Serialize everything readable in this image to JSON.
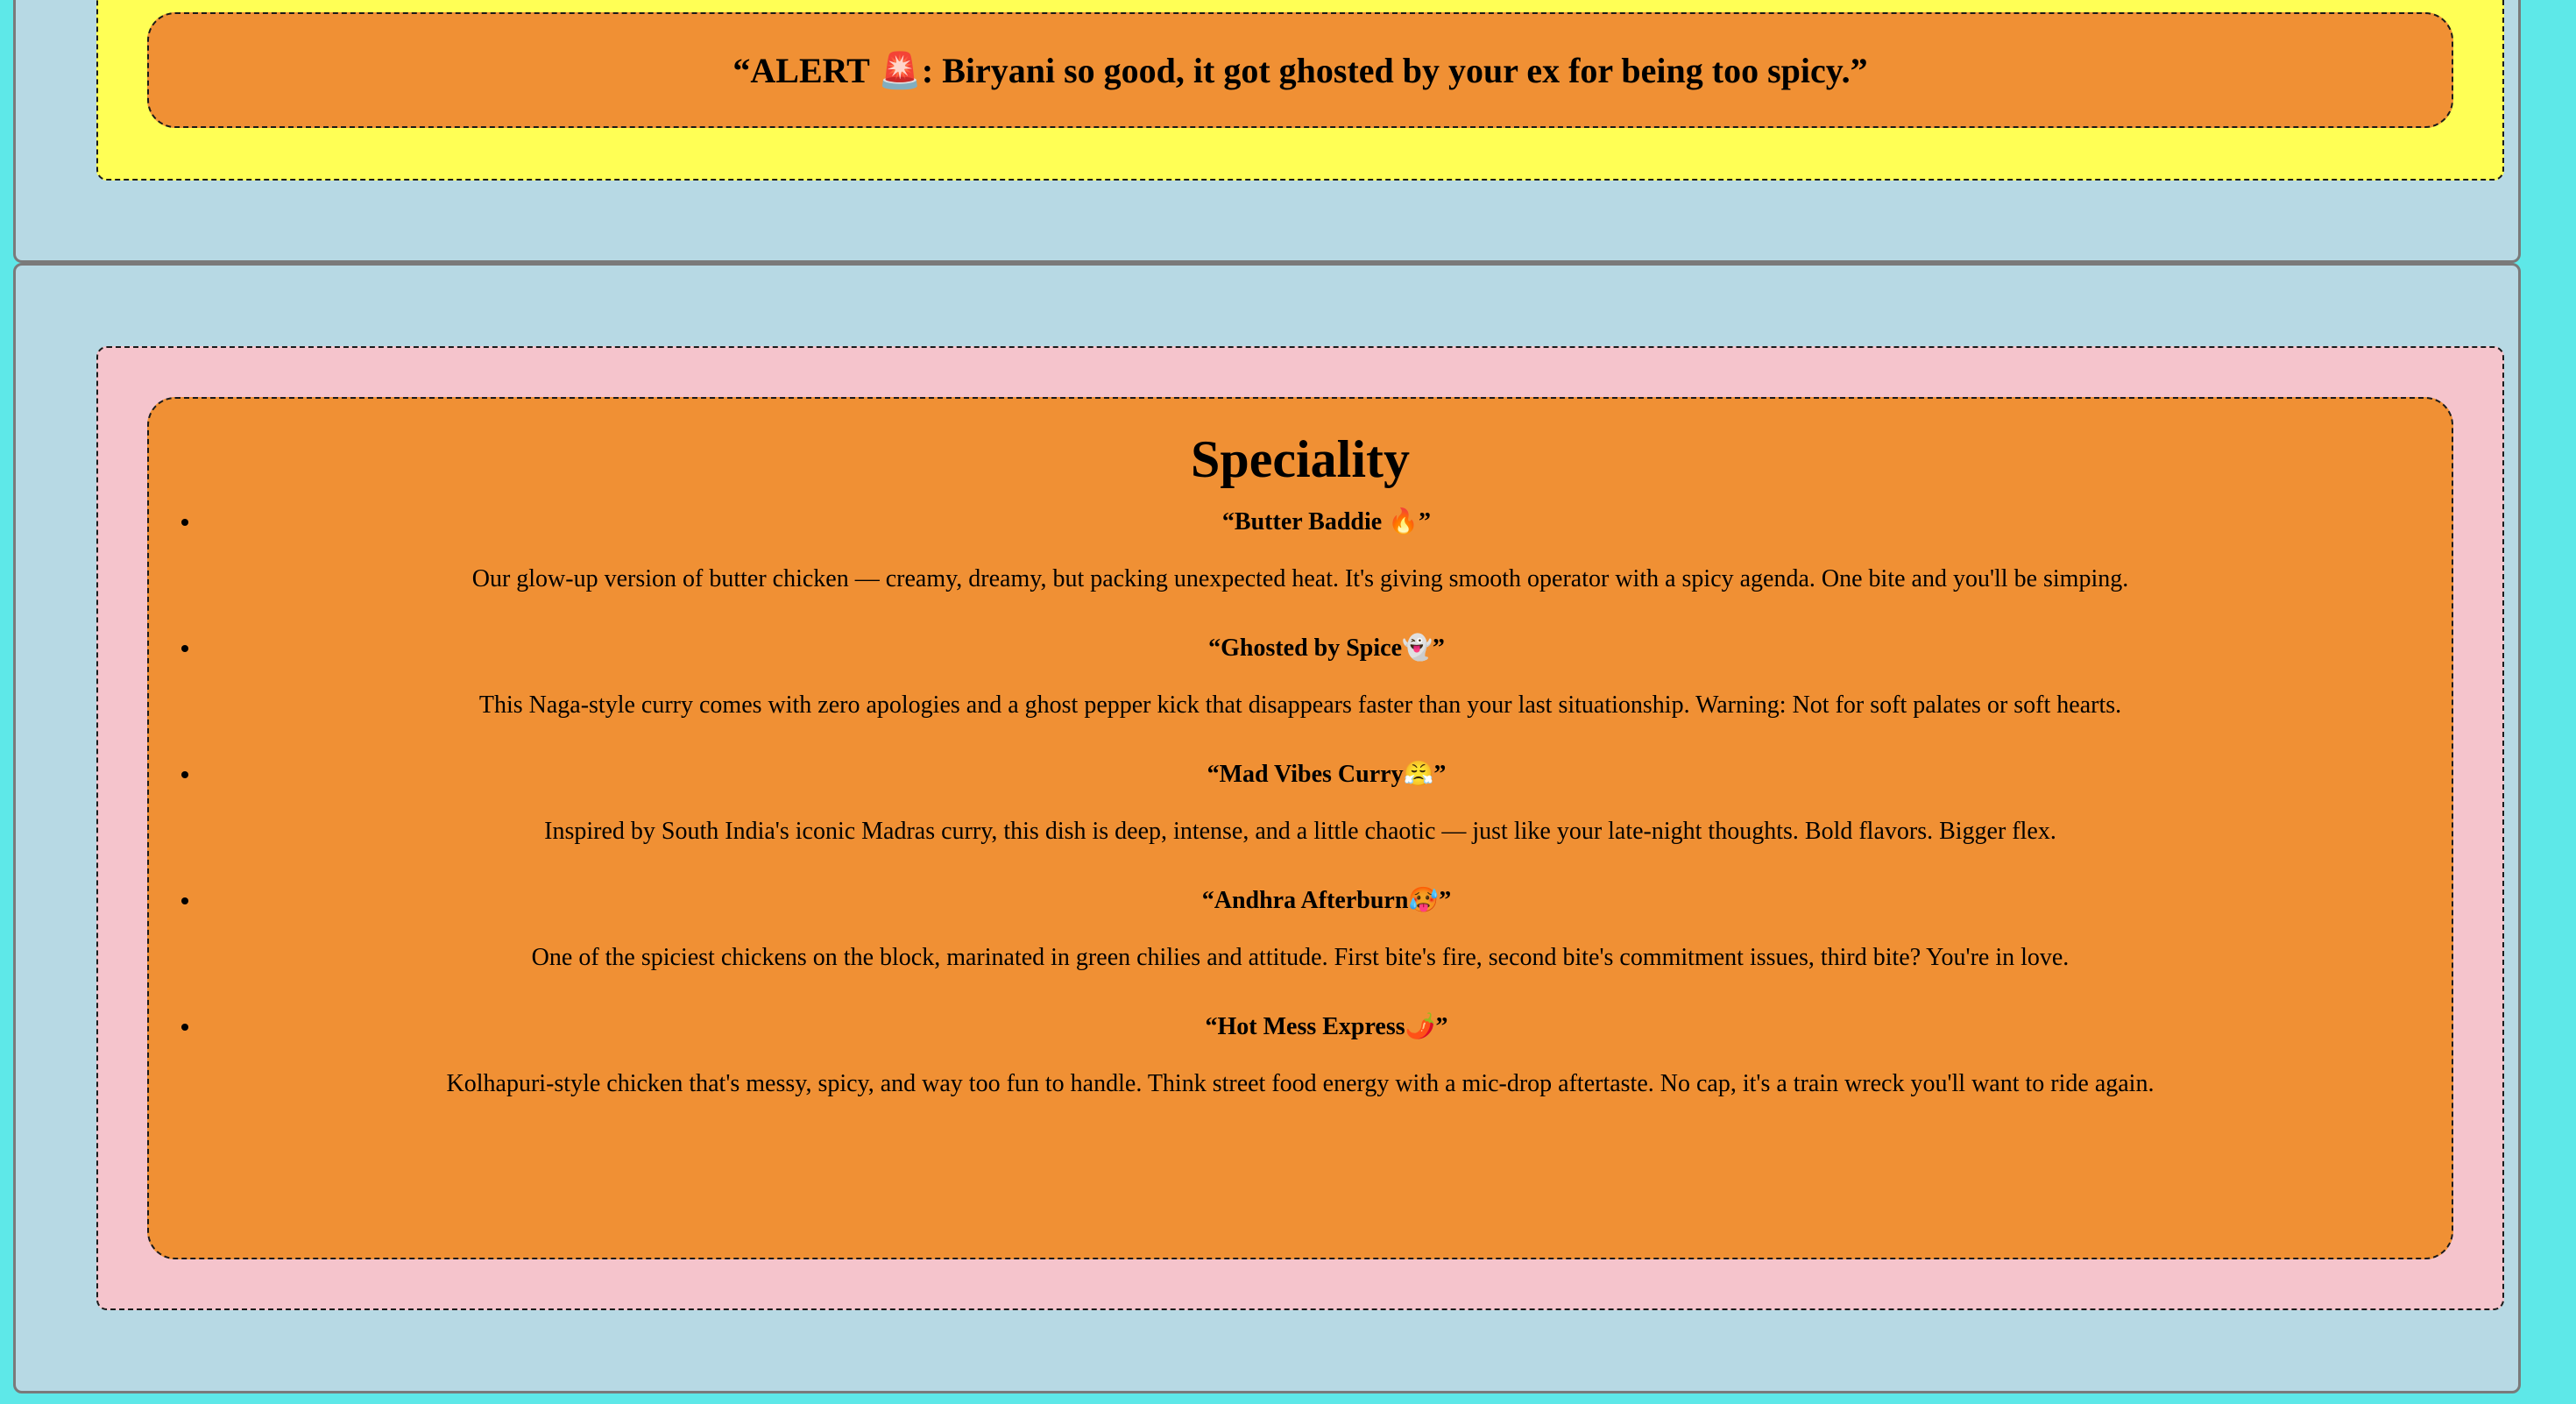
{
  "alert": {
    "text": "“ALERT 🚨: Biryani so good, it got ghosted by your ex for being too spicy.”"
  },
  "speciality": {
    "title": "Speciality",
    "items": [
      {
        "name": "“Butter Baddie 🔥”",
        "description": "Our glow-up version of butter chicken — creamy, dreamy, but packing unexpected heat. It's giving smooth operator with a spicy agenda. One bite and you'll be simping."
      },
      {
        "name": "“Ghosted by Spice👻”",
        "description": "This Naga-style curry comes with zero apologies and a ghost pepper kick that disappears faster than your last situationship. Warning: Not for soft palates or soft hearts."
      },
      {
        "name": "“Mad Vibes Curry😤”",
        "description": "Inspired by South India's iconic Madras curry, this dish is deep, intense, and a little chaotic — just like your late-night thoughts. Bold flavors. Bigger flex."
      },
      {
        "name": "“Andhra Afterburn🥵”",
        "description": "One of the spiciest chickens on the block, marinated in green chilies and attitude. First bite's fire, second bite's commitment issues, third bite? You're in love."
      },
      {
        "name": "“Hot Mess Express🌶️”",
        "description": "Kolhapuri-style chicken that's messy, spicy, and way too fun to handle. Think street food energy with a mic-drop aftertaste. No cap, it's a train wreck you'll want to ride again."
      }
    ]
  },
  "colors": {
    "page_background": "#5ee8e8",
    "section_background": "#b7d9e4",
    "alert_outer": "#ffff55",
    "speciality_outer": "#f5c4cc",
    "inner_box": "#f09034"
  }
}
